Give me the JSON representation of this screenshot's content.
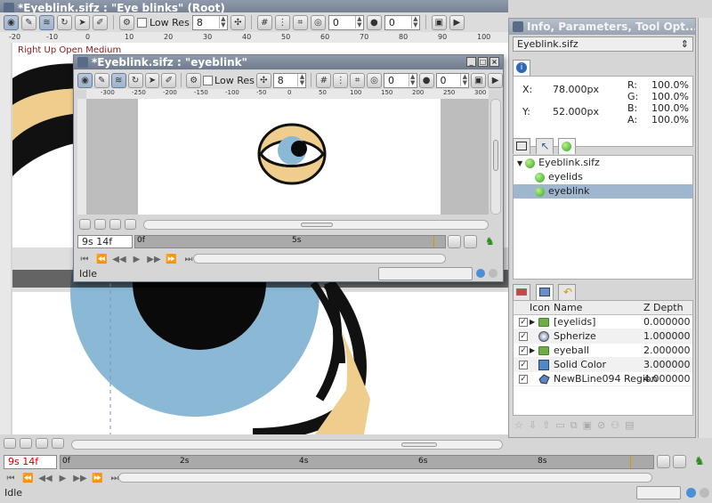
{
  "main_window": {
    "title": "*Eyeblink.sifz : \"Eye blinks\" (Root)",
    "canvas_label": "Right Up Open Medium",
    "low_res_label": "Low Res",
    "zoom_value": "8",
    "field_a": "0",
    "field_b": "0",
    "ruler_ticks": [
      "-20",
      "-10",
      "0",
      "10",
      "20",
      "30",
      "40",
      "50",
      "60",
      "70",
      "80",
      "90",
      "100"
    ],
    "time_value": "9s 14f",
    "time_ticks": [
      "0f",
      "2s",
      "4s",
      "6s",
      "8s"
    ],
    "status": "Idle"
  },
  "sub_window": {
    "title": "*Eyeblink.sifz : \"eyeblink\"",
    "low_res_label": "Low Res",
    "zoom_value": "8",
    "field_a": "0",
    "field_b": "0",
    "ruler_ticks": [
      "-300",
      "-250",
      "-200",
      "-150",
      "-100",
      "-50",
      "0",
      "50",
      "100",
      "150",
      "200",
      "250",
      "300"
    ],
    "time_value": "9s 14f",
    "time_ticks": [
      "0f",
      "5s"
    ],
    "status": "Idle"
  },
  "info_panel": {
    "title": "Info, Parameters, Tool Opt...",
    "file_select": "Eyeblink.sifz",
    "x_label": "X:",
    "x_value": "78.000px",
    "y_label": "Y:",
    "y_value": "52.000px",
    "r_label": "R:",
    "r_value": "100.0%",
    "g_label": "G:",
    "g_value": "100.0%",
    "b_label": "B:",
    "b_value": "100.0%",
    "a_label": "A:",
    "a_value": "100.0%"
  },
  "canvas_tree": {
    "items": [
      {
        "label": "Eyeblink.sifz"
      },
      {
        "label": "eyelids"
      },
      {
        "label": "eyeblink"
      }
    ]
  },
  "layers": {
    "headers": {
      "icon": "Icon",
      "name": "Name",
      "z_depth": "Z Depth"
    },
    "rows": [
      {
        "name": "[eyelids]",
        "z": "0.000000",
        "icon": "folder-icon"
      },
      {
        "name": "Spherize",
        "z": "1.000000",
        "icon": "spherize-icon"
      },
      {
        "name": "eyeball",
        "z": "2.000000",
        "icon": "folder-icon"
      },
      {
        "name": "Solid Color",
        "z": "3.000000",
        "icon": "solid-color-icon"
      },
      {
        "name": "NewBLine094 Region",
        "z": "4.000000",
        "icon": "region-icon"
      }
    ]
  },
  "colors": {
    "iris": "#8bb8d4",
    "skin": "#efcd8c",
    "outline": "#111111",
    "selection": "#9fb6cf",
    "titlebar": "#6f7b8d"
  }
}
